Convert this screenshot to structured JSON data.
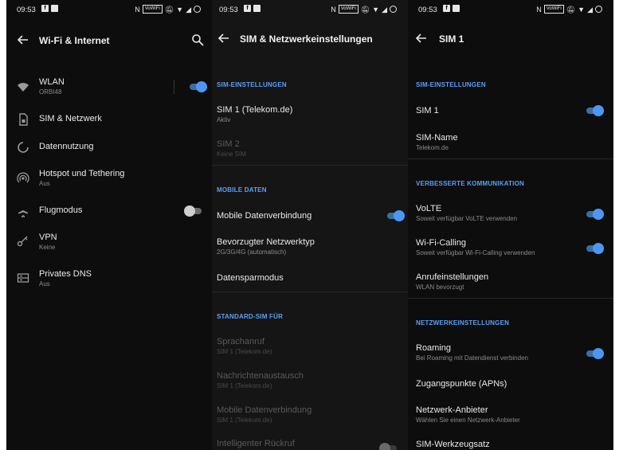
{
  "status_time": "09:53",
  "status_nfc_glyph": "N",
  "status_volte_tag": "VoWiFi",
  "screen1": {
    "title": "Wi-Fi & Internet",
    "items": [
      {
        "title": "WLAN",
        "subtitle": "ORBI48",
        "icon": "wifi-icon",
        "toggle": "on"
      },
      {
        "title": "SIM & Netzwerk",
        "subtitle": "",
        "icon": "sim-card-icon"
      },
      {
        "title": "Datennutzung",
        "subtitle": "",
        "icon": "data-usage-icon"
      },
      {
        "title": "Hotspot und Tethering",
        "subtitle": "Aus",
        "icon": "hotspot-icon"
      },
      {
        "title": "Flugmodus",
        "subtitle": "",
        "icon": "airplane-icon",
        "toggle": "off"
      },
      {
        "title": "VPN",
        "subtitle": "Keine",
        "icon": "vpn-key-icon"
      },
      {
        "title": "Privates DNS",
        "subtitle": "Aus",
        "icon": "dns-icon"
      }
    ]
  },
  "screen2": {
    "title": "SIM & Netzwerkeinstellungen",
    "section1": "SIM-EINSTELLUNGEN",
    "sim1_title": "SIM 1  (Telekom.de)",
    "sim1_sub": "Aktiv",
    "sim2_title": "SIM 2",
    "sim2_sub": "Keine SIM",
    "section2": "MOBILE DATEN",
    "mobile_data": "Mobile Datenverbindung",
    "net_type": "Bevorzugter Netzwerktyp",
    "net_type_sub": "2G/3G/4G (automatisch)",
    "data_saver": "Datensparmodus",
    "section3": "STANDARD-SIM FÜR",
    "voice": "Sprachanruf",
    "voice_sub": "SIM 1  (Telekom.de)",
    "msg": "Nachrichtenaustausch",
    "msg_sub": "SIM 1  (Telekom.de)",
    "mdata": "Mobile Datenverbindung",
    "mdata_sub": "SIM 1  (Telekom.de)",
    "smart_call": "Intelligenter Rückruf"
  },
  "screen3": {
    "title": "SIM 1",
    "section1": "SIM-EINSTELLUNGEN",
    "sim1": "SIM 1",
    "sim_name": "SIM-Name",
    "sim_name_sub": "Telekom.de",
    "section2": "VERBESSERTE KOMMUNIKATION",
    "volte": "VoLTE",
    "volte_sub": "Soweit verfügbar VoLTE verwenden",
    "wifi_calling": "Wi-Fi-Calling",
    "wifi_calling_sub": "Soweit verfügbar Wi-Fi-Calling verwenden",
    "call_settings": "Anrufeinstellungen",
    "call_settings_sub": "WLAN bevorzugt",
    "section3": "NETZWERKEINSTELLUNGEN",
    "roaming": "Roaming",
    "roaming_sub": "Bei Roaming mit Datendienst verbinden",
    "apn": "Zugangspunkte (APNs)",
    "operator": "Netzwerk-Anbieter",
    "operator_sub": "Wählen Sie einen Netzwerk-Anbieter",
    "toolkit": "SIM-Werkzeugsatz"
  },
  "colors": {
    "accent": "#4d97f3",
    "section": "#5aa0f5",
    "bg": "#0d0d0d"
  }
}
